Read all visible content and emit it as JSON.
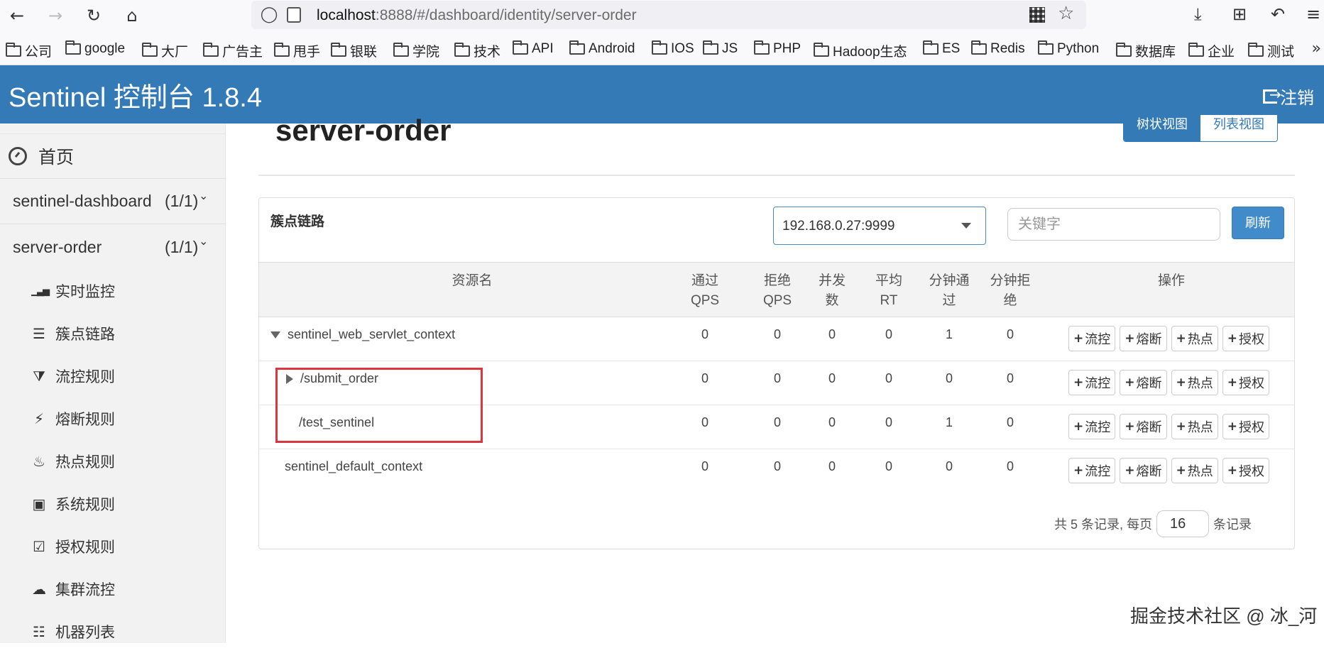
{
  "browser": {
    "url_host": "localhost",
    "url_rest": ":8888/#/dashboard/identity/server-order",
    "bookmarks": [
      "公司",
      "google",
      "大厂",
      "广告主",
      "甩手",
      "银联",
      "学院",
      "技术",
      "API",
      "Android",
      "IOS",
      "JS",
      "PHP",
      "Hadoop生态",
      "ES",
      "Redis",
      "Python",
      "数据库",
      "企业",
      "测试"
    ]
  },
  "header": {
    "title": "Sentinel 控制台 1.8.4",
    "logout_label": "注销",
    "color": "#337ab7"
  },
  "sidebar": {
    "home_label": "首页",
    "apps": [
      {
        "name": "sentinel-dashboard",
        "count": "(1/1)"
      },
      {
        "name": "server-order",
        "count": "(1/1)"
      }
    ],
    "items": [
      {
        "label": "实时监控",
        "icon": "bar-chart-icon"
      },
      {
        "label": "簇点链路",
        "icon": "list-icon"
      },
      {
        "label": "流控规则",
        "icon": "filter-icon"
      },
      {
        "label": "熔断规则",
        "icon": "bolt-icon"
      },
      {
        "label": "热点规则",
        "icon": "fire-icon"
      },
      {
        "label": "系统规则",
        "icon": "lock-icon"
      },
      {
        "label": "授权规则",
        "icon": "check-square-icon"
      },
      {
        "label": "集群流控",
        "icon": "cloud-icon"
      },
      {
        "label": "机器列表",
        "icon": "th-list-icon"
      }
    ]
  },
  "main": {
    "page_title": "server-order",
    "view_tree_label": "树状视图",
    "view_list_label": "列表视图",
    "panel_title": "簇点链路",
    "machine_select": "192.168.0.27:9999",
    "keyword_placeholder": "关键字",
    "refresh_label": "刷新",
    "columns": [
      "资源名",
      "通过QPS",
      "拒绝QPS",
      "并发数",
      "平均RT",
      "分钟通过",
      "分钟拒绝",
      "操作"
    ],
    "rows": [
      {
        "name": "sentinel_web_servlet_context",
        "pass_qps": "0",
        "block_qps": "0",
        "threads": "0",
        "rt": "0",
        "min_pass": "1",
        "min_block": "0"
      },
      {
        "name": "/submit_order",
        "pass_qps": "0",
        "block_qps": "0",
        "threads": "0",
        "rt": "0",
        "min_pass": "0",
        "min_block": "0"
      },
      {
        "name": "/test_sentinel",
        "pass_qps": "0",
        "block_qps": "0",
        "threads": "0",
        "rt": "0",
        "min_pass": "1",
        "min_block": "0"
      },
      {
        "name": "sentinel_default_context",
        "pass_qps": "0",
        "block_qps": "0",
        "threads": "0",
        "rt": "0",
        "min_pass": "0",
        "min_block": "0"
      }
    ],
    "op_labels": [
      "流控",
      "熔断",
      "热点",
      "授权"
    ],
    "pager_prefix": "共 5 条记录, 每页",
    "page_size": "16",
    "pager_suffix": "条记录"
  },
  "watermark": "掘金技术社区 @ 冰_河"
}
